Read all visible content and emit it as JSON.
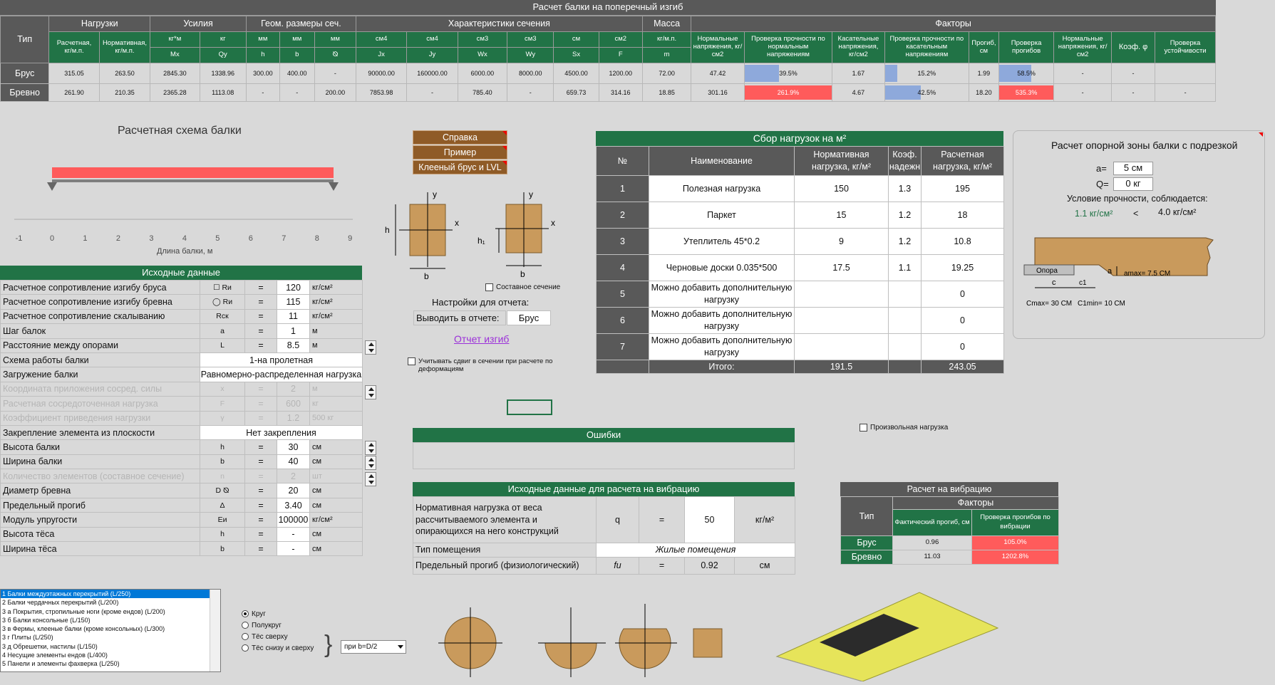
{
  "main_table": {
    "title": "Расчет балки на поперечный изгиб",
    "groups": [
      "Тип",
      "Нагрузки",
      "Усилия",
      "Геом. размеры сеч.",
      "Характеристики сечения",
      "Масса",
      "Факторы"
    ],
    "units": [
      "кг/м.п.",
      "кг/м.п.",
      "кг*м",
      "кг",
      "мм",
      "мм",
      "мм",
      "см4",
      "см4",
      "см3",
      "см3",
      "см",
      "см2",
      "кг/м.п."
    ],
    "col_headers_a": [
      "Расчетная,",
      "Нормативная,"
    ],
    "symbols": [
      "Mx",
      "Qy",
      "h",
      "b",
      "⦰",
      "Jx",
      "Jy",
      "Wx",
      "Wy",
      "Sx",
      "F",
      "m"
    ],
    "factor_headers": [
      "Нормальные напряжения, кг/см2",
      "Проверка прочности по нормальным напряжениям",
      "Касательные напряжения, кг/см2",
      "Проверка прочности по касательным напряжениям",
      "Прогиб, см",
      "Проверка прогибов",
      "Нормальные напряжения, кг/см2",
      "Коэф. φ",
      "Проверка устойчивости"
    ],
    "rows": [
      {
        "type": "Брус",
        "vals": [
          "315.05",
          "263.50",
          "2845.30",
          "1338.96",
          "300.00",
          "400.00",
          "-",
          "90000.00",
          "160000.00",
          "6000.00",
          "8000.00",
          "4500.00",
          "1200.00",
          "72.00"
        ],
        "f1": "47.42",
        "f2": "39.5%",
        "f2_pct": 39.5,
        "f3": "1.67",
        "f4": "15.2%",
        "f4_pct": 15.2,
        "f5": "1.99",
        "f6": "58.5%",
        "f6_pct": 58.5,
        "f7": "-",
        "f8": "-",
        "f9": ""
      },
      {
        "type": "Бревно",
        "vals": [
          "261.90",
          "210.35",
          "2365.28",
          "1113.08",
          "-",
          "-",
          "200.00",
          "7853.98",
          "-",
          "785.40",
          "-",
          "659.73",
          "314.16",
          "18.85"
        ],
        "f1": "301.16",
        "f2": "261.9%",
        "f2_pct": 261.9,
        "f3": "4.67",
        "f4": "42.5%",
        "f4_pct": 42.5,
        "f5": "18.20",
        "f6": "535.3%",
        "f6_pct": 535.3,
        "f7": "-",
        "f8": "-",
        "f9": "-"
      }
    ]
  },
  "scheme": {
    "title": "Расчетная схема балки",
    "xlabel": "Длина балки, м",
    "ticks": [
      "-1",
      "0",
      "1",
      "2",
      "3",
      "4",
      "5",
      "6",
      "7",
      "8",
      "9"
    ],
    "beam_length": 8.5
  },
  "buttons": {
    "help": "Справка",
    "example": "Пример",
    "glulam": "Клееный брус и LVL"
  },
  "section": {
    "h": "h",
    "b": "b",
    "x": "x",
    "y": "y",
    "h1": "h₁",
    "composite": "Составное сечение"
  },
  "report": {
    "title": "Настройки для отчета:",
    "label": "Выводить в отчете:",
    "value": "Брус",
    "link": "Отчет изгиб"
  },
  "shear_option": "Учитывать сдвиг в сечении при расчете по деформациям",
  "input": {
    "title": "Исходные данные",
    "rows": [
      {
        "label": "Расчетное сопротивление изгибу бруса",
        "sym": "☐ Rи",
        "eq": "=",
        "val": "120",
        "unit": "кг/см²"
      },
      {
        "label": "Расчетное сопротивление изгибу бревна",
        "sym": "◯ Rи",
        "eq": "=",
        "val": "115",
        "unit": "кг/см²"
      },
      {
        "label": "Расчетное сопротивление скалыванию",
        "sym": "Rск",
        "eq": "=",
        "val": "11",
        "unit": "кг/см²"
      },
      {
        "label": "Шаг балок",
        "sym": "a",
        "eq": "=",
        "val": "1",
        "unit": "м"
      },
      {
        "label": "Расстояние между опорами",
        "sym": "L",
        "eq": "=",
        "val": "8.5",
        "unit": "м"
      },
      {
        "label": "Схема работы балки",
        "wide": "1-на пролетная"
      },
      {
        "label": "Загружение балки",
        "wide": "Равномерно-распределенная нагрузка"
      },
      {
        "label": "Координата приложения сосред. силы",
        "sym": "x",
        "eq": "=",
        "val": "2",
        "unit": "м",
        "dis": true
      },
      {
        "label": "Расчетная сосредоточенная нагрузка",
        "sym": "F",
        "eq": "=",
        "val": "600",
        "unit": "кг",
        "dis": true
      },
      {
        "label": "Коэффициент приведения нагрузки",
        "sym": "γ",
        "eq": "=",
        "val": "1.2",
        "unit": "500 кг",
        "dis": true
      },
      {
        "label": "Закрепление элемента из плоскости",
        "wide": "Нет закрепления"
      },
      {
        "label": "Высота балки",
        "sym": "h",
        "eq": "=",
        "val": "30",
        "unit": "см"
      },
      {
        "label": "Ширина балки",
        "sym": "b",
        "eq": "=",
        "val": "40",
        "unit": "см"
      },
      {
        "label": "Количество элементов (составное сечение)",
        "sym": "n",
        "eq": "=",
        "val": "2",
        "unit": "шт",
        "dis": true
      },
      {
        "label": "Диаметр бревна",
        "sym": "D ⦰",
        "eq": "=",
        "val": "20",
        "unit": "см"
      },
      {
        "label": "Предельный прогиб",
        "sym": "Δ",
        "eq": "=",
        "val": "3.40",
        "unit": "см"
      },
      {
        "label": "Модуль упругости",
        "sym": "Eи",
        "eq": "=",
        "val": "100000",
        "unit": "кг/см²"
      },
      {
        "label": "Высота тёса",
        "sym": "h",
        "eq": "=",
        "val": "-",
        "unit": "см"
      },
      {
        "label": "Ширина тёса",
        "sym": "b",
        "eq": "=",
        "val": "-",
        "unit": "см"
      }
    ]
  },
  "loads": {
    "title": "Сбор нагрузок на м²",
    "headers": [
      "№",
      "Наименование",
      "Нормативная нагрузка, кг/м²",
      "Коэф. надежн",
      "Расчетная нагрузка, кг/м²"
    ],
    "rows": [
      [
        "1",
        "Полезная нагрузка",
        "150",
        "1.3",
        "195"
      ],
      [
        "2",
        "Паркет",
        "15",
        "1.2",
        "18"
      ],
      [
        "3",
        "Утеплитель 45*0.2",
        "9",
        "1.2",
        "10.8"
      ],
      [
        "4",
        "Черновые доски 0.035*500",
        "17.5",
        "1.1",
        "19.25"
      ],
      [
        "5",
        "Можно добавить дополнительную нагрузку",
        "",
        "",
        "0"
      ],
      [
        "6",
        "Можно добавить дополнительную нагрузку",
        "",
        "",
        "0"
      ],
      [
        "7",
        "Можно добавить дополнительную нагрузку",
        "",
        "",
        "0"
      ]
    ],
    "total_label": "Итого:",
    "total_norm": "191.5",
    "total_calc": "243.05"
  },
  "support": {
    "title": "Расчет опорной зоны балки с подрезкой",
    "a_label": "a=",
    "a_val": "5 см",
    "q_label": "Q=",
    "q_val": "0 кг",
    "cond": "Условие прочности, соблюдается:",
    "left": "1.1 кг/см²",
    "op": "<",
    "right": "4.0 кг/см²",
    "opora": "Опора",
    "a_sym": "a",
    "amax": "amax= 7.5 СМ",
    "c": "c",
    "c1": "c1",
    "cmax": "Cmax= 30 СМ",
    "c1min": "C1min= 10 СМ"
  },
  "errors": {
    "title": "Ошибки"
  },
  "arbitrary": "Произвольная нагрузка",
  "vib_input": {
    "title": "Исходные данные для расчета на вибрацию",
    "row1": "Нормативная нагрузка от веса рассчитываемого элемента и опирающихся на него конструкций",
    "q": "q",
    "eq": "=",
    "qval": "50",
    "qunit": "кг/м²",
    "room_label": "Тип помещения",
    "room_val": "Жилые помещения",
    "def_label": "Предельный прогиб (физиологический)",
    "fu": "fu",
    "def_val": "0.92",
    "def_unit": "см"
  },
  "vib": {
    "title": "Расчет на вибрацию",
    "type": "Тип",
    "factors": "Факторы",
    "h1": "Фактический прогиб, см",
    "h2": "Проверка прогибов по вибрации",
    "rows": [
      {
        "type": "Брус",
        "a": "0.96",
        "b": "105.0%"
      },
      {
        "type": "Бревно",
        "a": "11.03",
        "b": "1202.8%"
      }
    ]
  },
  "list": {
    "items": [
      "1 Балки междуэтажных перекрытий (L/250)",
      "2 Балки чердачных перекрытий (L/200)",
      "3 а Покрытия, стропильные ноги (кроме ендов) (L/200)",
      "3 б Балки консольные (L/150)",
      "3 в Фермы, клееные балки (кроме консольных) (L/300)",
      "3 г Плиты (L/250)",
      "3 д Обрешетки, настилы (L/150)",
      "4 Несущие элементы ендов (L/400)",
      "5 Панели и элементы фахверка (L/250)"
    ]
  },
  "radios": {
    "items": [
      "Круг",
      "Полукруг",
      "Тёс сверху",
      "Тёс снизу и сверху"
    ],
    "select": "при b=D/2"
  },
  "colors": {
    "green": "#217346",
    "gray": "#595959",
    "red": "#ff5b5b",
    "blue": "#8ea9db"
  }
}
